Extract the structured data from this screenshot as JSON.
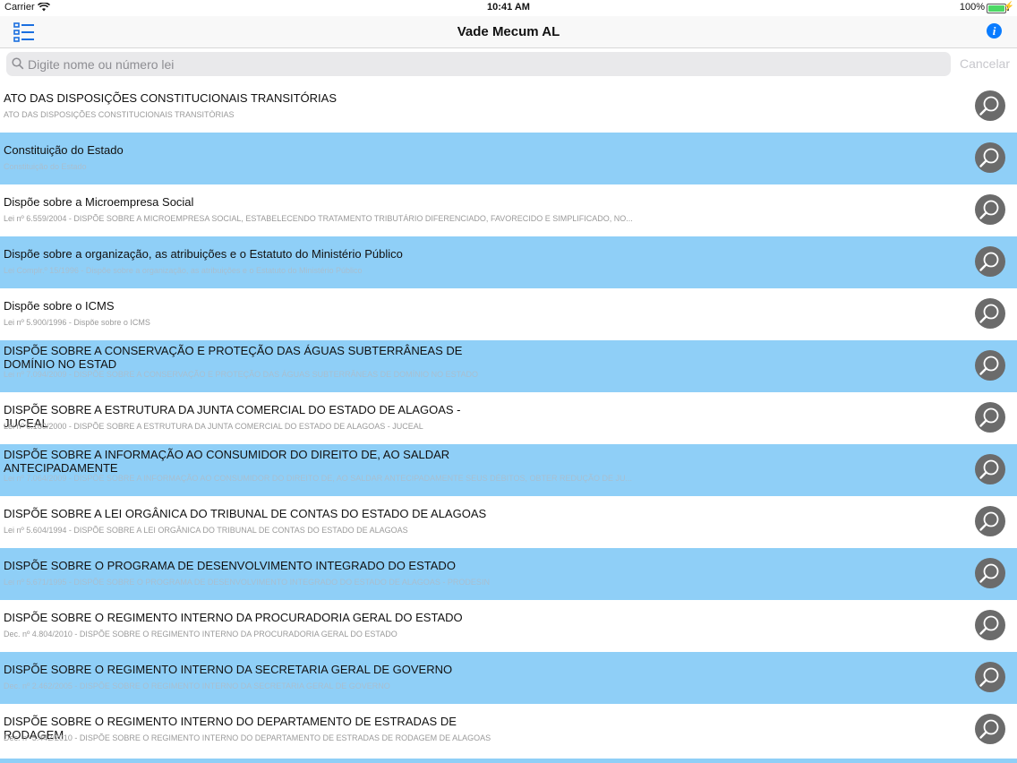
{
  "status": {
    "carrier": "Carrier",
    "time": "10:41 AM",
    "battery": "100%"
  },
  "nav": {
    "title": "Vade Mecum AL",
    "list_icon": "list-icon",
    "info_icon": "info-icon",
    "info_glyph": "i"
  },
  "search": {
    "placeholder": "Digite nome ou número lei",
    "value": "",
    "cancel_label": "Cancelar"
  },
  "colors": {
    "row_alt": "#8fcff7",
    "accent": "#0a7cff",
    "search_button": "#6b6b6b"
  },
  "laws": [
    {
      "title": "ATO DAS DISPOSIÇÕES CONSTITUCIONAIS TRANSITÓRIAS",
      "subtitle": "ATO DAS DISPOSIÇÕES CONSTITUCIONAIS TRANSITÓRIAS"
    },
    {
      "title": "Constituição do Estado",
      "subtitle": "Constituição do Estado"
    },
    {
      "title": "Dispõe sobre a Microempresa Social",
      "subtitle": "Lei nº 6.559/2004 - DISPÕE SOBRE A MICROEMPRESA SOCIAL, ESTABELECENDO TRATAMENTO TRIBUTÁRIO DIFERENCIADO, FAVORECIDO E SIMPLIFICADO, NO..."
    },
    {
      "title": "Dispõe sobre a organização, as atribuições e o Estatuto do Ministério Público",
      "subtitle": "Lei Complr.º 15/1996 - Dispõe sobre a organização, as atribuições e o Estatuto do Ministério Público"
    },
    {
      "title": "Dispõe sobre o ICMS",
      "subtitle": "Lei nº 5.900/1996 - Dispõe sobre o ICMS"
    },
    {
      "title": "DISPÕE SOBRE A CONSERVAÇÃO E PROTEÇÃO DAS ÁGUAS SUBTERRÂNEAS DE DOMÍNIO NO ESTAD",
      "subtitle": "Lei nº 7.094/2009 - DISPÕE SOBRE A CONSERVAÇÃO E PROTEÇÃO DAS ÁGUAS SUBTERRÂNEAS DE DOMÍNIO NO ESTADO"
    },
    {
      "title": "DISPÕE SOBRE A ESTRUTURA DA JUNTA COMERCIAL DO ESTADO DE ALAGOAS - JUCEAL",
      "subtitle": "Lei nº 6.180/2000 - DISPÕE SOBRE A ESTRUTURA DA JUNTA COMERCIAL DO ESTADO DE ALAGOAS - JUCEAL"
    },
    {
      "title": "DISPÕE SOBRE A INFORMAÇÃO AO CONSUMIDOR DO DIREITO DE, AO SALDAR ANTECIPADAMENTE",
      "subtitle": "Lei nº 7.064/2009 - DISPÕE SOBRE A INFORMAÇÃO AO CONSUMIDOR DO DIREITO DE, AO SALDAR ANTECIPADAMENTE SEUS DÉBITOS, OBTER REDUÇÃO DE JU..."
    },
    {
      "title": "DISPÕE SOBRE A LEI ORGÂNICA DO TRIBUNAL DE CONTAS DO ESTADO DE ALAGOAS",
      "subtitle": "Lei nº 5.604/1994 - DISPÕE SOBRE A LEI ORGÂNICA DO TRIBUNAL DE CONTAS DO ESTADO DE ALAGOAS"
    },
    {
      "title": "DISPÕE SOBRE O PROGRAMA DE DESENVOLVIMENTO INTEGRADO DO ESTADO",
      "subtitle": "Lei nº 5.671/1995 - DISPÕE SOBRE O PROGRAMA DE DESENVOLVIMENTO INTEGRADO DO ESTADO DE ALAGOAS - PRODESIN"
    },
    {
      "title": "DISPÕE SOBRE O REGIMENTO INTERNO DA PROCURADORIA GERAL DO ESTADO",
      "subtitle": "Dec. nº 4.804/2010 - DISPÕE SOBRE O REGIMENTO INTERNO DA PROCURADORIA GERAL DO ESTADO"
    },
    {
      "title": "DISPÕE SOBRE O REGIMENTO INTERNO DA SECRETARIA GERAL DE GOVERNO",
      "subtitle": "Dec. nº 2.462/2005 - DISPÕE SOBRE O REGIMENTO INTERNO DA SECRETARIA GERAL DE GOVERNO"
    },
    {
      "title": "DISPÕE SOBRE O REGIMENTO INTERNO DO DEPARTAMENTO DE ESTRADAS DE RODAGEM",
      "subtitle": "Dec. nº 5.442/2010 - DISPÕE SOBRE O REGIMENTO INTERNO DO DEPARTAMENTO DE ESTRADAS DE RODAGEM DE ALAGOAS"
    }
  ]
}
